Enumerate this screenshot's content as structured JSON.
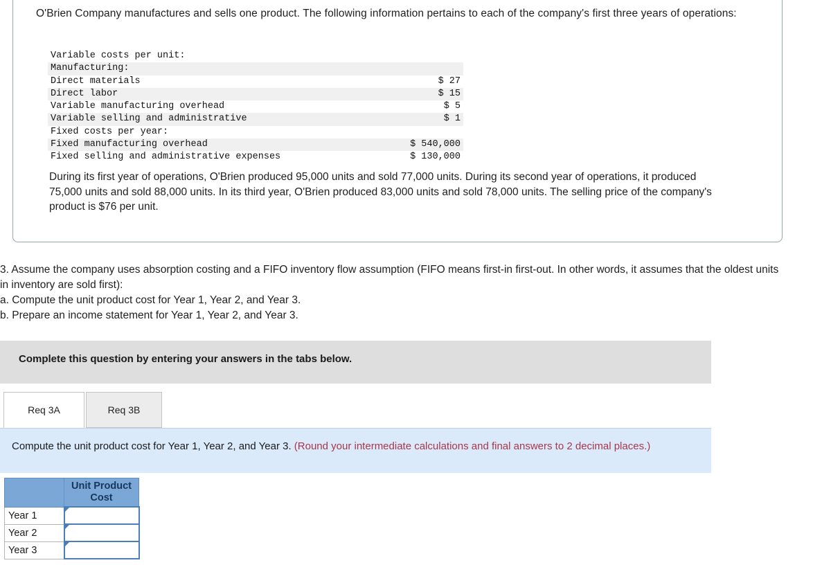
{
  "scenario": {
    "intro": "O'Brien Company manufactures and sells one product. The following information pertains to each of the company's first three years of operations:",
    "cost_table": {
      "rows": [
        {
          "label": "Variable costs per unit:",
          "indent": 0,
          "amount": "",
          "shaded": false
        },
        {
          "label": "Manufacturing:",
          "indent": 1,
          "amount": "",
          "shaded": true
        },
        {
          "label": "Direct materials",
          "indent": 2,
          "amount": "$ 27",
          "shaded": false
        },
        {
          "label": "Direct labor",
          "indent": 2,
          "amount": "$ 15",
          "shaded": true
        },
        {
          "label": "Variable manufacturing overhead",
          "indent": 2,
          "amount": "$ 5",
          "shaded": false
        },
        {
          "label": "Variable selling and administrative",
          "indent": 1,
          "amount": "$ 1",
          "shaded": true
        },
        {
          "label": "Fixed costs per year:",
          "indent": 0,
          "amount": "",
          "shaded": false
        },
        {
          "label": "Fixed manufacturing overhead",
          "indent": 1,
          "amount": "$ 540,000",
          "shaded": true
        },
        {
          "label": "Fixed selling and administrative expenses",
          "indent": 1,
          "amount": "$ 130,000",
          "shaded": false
        }
      ]
    },
    "note": "During its first year of operations, O'Brien produced 95,000 units and sold 77,000 units. During its second year of operations, it produced 75,000 units and sold 88,000 units. In its third year, O'Brien produced 83,000 units and sold 78,000 units. The selling price of the company's product is $76 per unit."
  },
  "requirement": {
    "line1": "3. Assume the company uses absorption costing and a FIFO inventory flow assumption (FIFO means first-in first-out. In other words, it assumes that the oldest units in inventory are sold first):",
    "line2": "a. Compute the unit product cost for Year 1, Year 2, and Year 3.",
    "line3": "b. Prepare an income statement for Year 1, Year 2, and Year 3."
  },
  "complete_bar": {
    "text": "Complete this question by entering your answers in the tabs below."
  },
  "tabs": [
    {
      "label": "Req 3A",
      "active": true
    },
    {
      "label": "Req 3B",
      "active": false
    }
  ],
  "blue_panel": {
    "prompt": "Compute the unit product cost for Year 1, Year 2, and Year 3. ",
    "hint": "(Round your intermediate calculations and final answers to 2 decimal places.)"
  },
  "answer_table": {
    "blank_header": "",
    "column_header": "Unit Product Cost",
    "rows": [
      {
        "label": "Year 1",
        "value": ""
      },
      {
        "label": "Year 2",
        "value": ""
      },
      {
        "label": "Year 3",
        "value": ""
      }
    ]
  },
  "colors": {
    "header_blue": "#7ba7d7",
    "panel_blue": "#dbeafa",
    "hint_red": "#a8364a",
    "bar_gray": "#dedede",
    "input_border": "#4a7ebb"
  }
}
